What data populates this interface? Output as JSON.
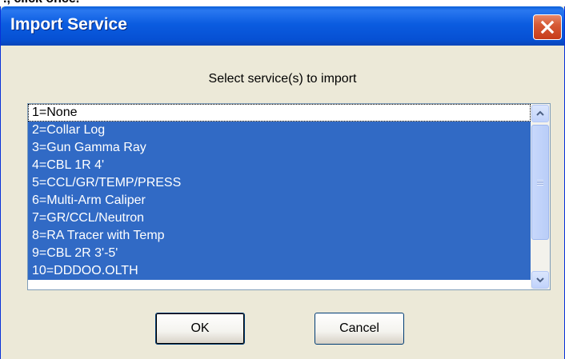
{
  "above_text": "., click once.",
  "dialog": {
    "title": "Import Service",
    "close_icon": "close-x-icon",
    "prompt": "Select service(s) to import",
    "items": [
      {
        "label": "1=None",
        "selected": false
      },
      {
        "label": "2=Collar Log",
        "selected": true
      },
      {
        "label": "3=Gun Gamma Ray",
        "selected": true
      },
      {
        "label": "4=CBL 1R 4'",
        "selected": true
      },
      {
        "label": "5=CCL/GR/TEMP/PRESS",
        "selected": true
      },
      {
        "label": "6=Multi-Arm Caliper",
        "selected": true
      },
      {
        "label": "7=GR/CCL/Neutron",
        "selected": true
      },
      {
        "label": "8=RA Tracer with Temp",
        "selected": true
      },
      {
        "label": "9=CBL 2R 3'-5'",
        "selected": true
      },
      {
        "label": "10=DDDOO.OLTH",
        "selected": true
      }
    ],
    "ok_label": "OK",
    "cancel_label": "Cancel"
  },
  "colors": {
    "selection": "#316ac5",
    "titlebar": "#0b5ce0",
    "dialog_bg": "#ece9d8"
  }
}
